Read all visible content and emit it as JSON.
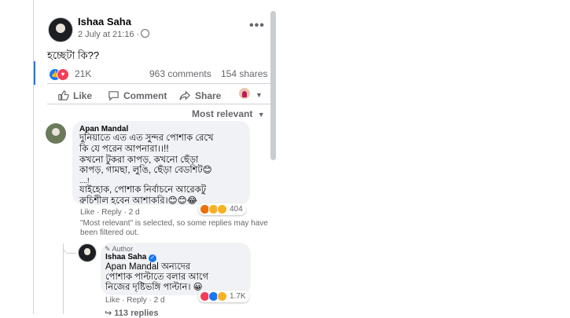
{
  "post": {
    "author": "Ishaa Saha",
    "meta": "2 July at 21:16 ·",
    "text": "হচ্ছেটা কি??",
    "more_icon": "more-icon",
    "reaction_count": "21K",
    "comments_count": "963 comments",
    "shares_count": "154 shares"
  },
  "actions": {
    "like": "Like",
    "comment": "Comment",
    "share": "Share"
  },
  "sort": {
    "label": "Most relevant",
    "icon": "caret-down-icon"
  },
  "comment": {
    "author": "Apan Mandal",
    "lines": [
      "দুনিয়াতে এত এত সুন্দর পোশাক রেখে",
      "কি যে পরেন আপনারা।।!!",
      "কখনো টুকরা কাপড়, কখনো ছেঁড়া",
      "কাপড়, গামছা, লুঙি, ছেঁড়া বেডশিট😊",
      "....!",
      "যাইহোক, পোশাক নির্বাচনে আরেকটু",
      "রুচিশীল হবেন আশাকরি।😊😊😂"
    ],
    "reaction_count": "404",
    "actions": "Like · Reply · 2 d"
  },
  "filter_note": "\"Most relevant\" is selected, so some replies may have been filtered out.",
  "reply": {
    "badge": "Author",
    "author": "Ishaa Saha",
    "lines": [
      "Apan Mandal অন্যদের",
      "পোশাক পাল্টাতে বলার আগে",
      "নিজের দৃষ্টিভঙ্গি পাল্টান। 😀"
    ],
    "reaction_count": "1.7K",
    "actions": "Like · Reply · 2 d"
  },
  "replies_link": "↪ 113 replies",
  "colors": {
    "accent": "#1877f2",
    "love": "#f33e58",
    "haha": "#f7b125",
    "angry": "#e9710f"
  }
}
